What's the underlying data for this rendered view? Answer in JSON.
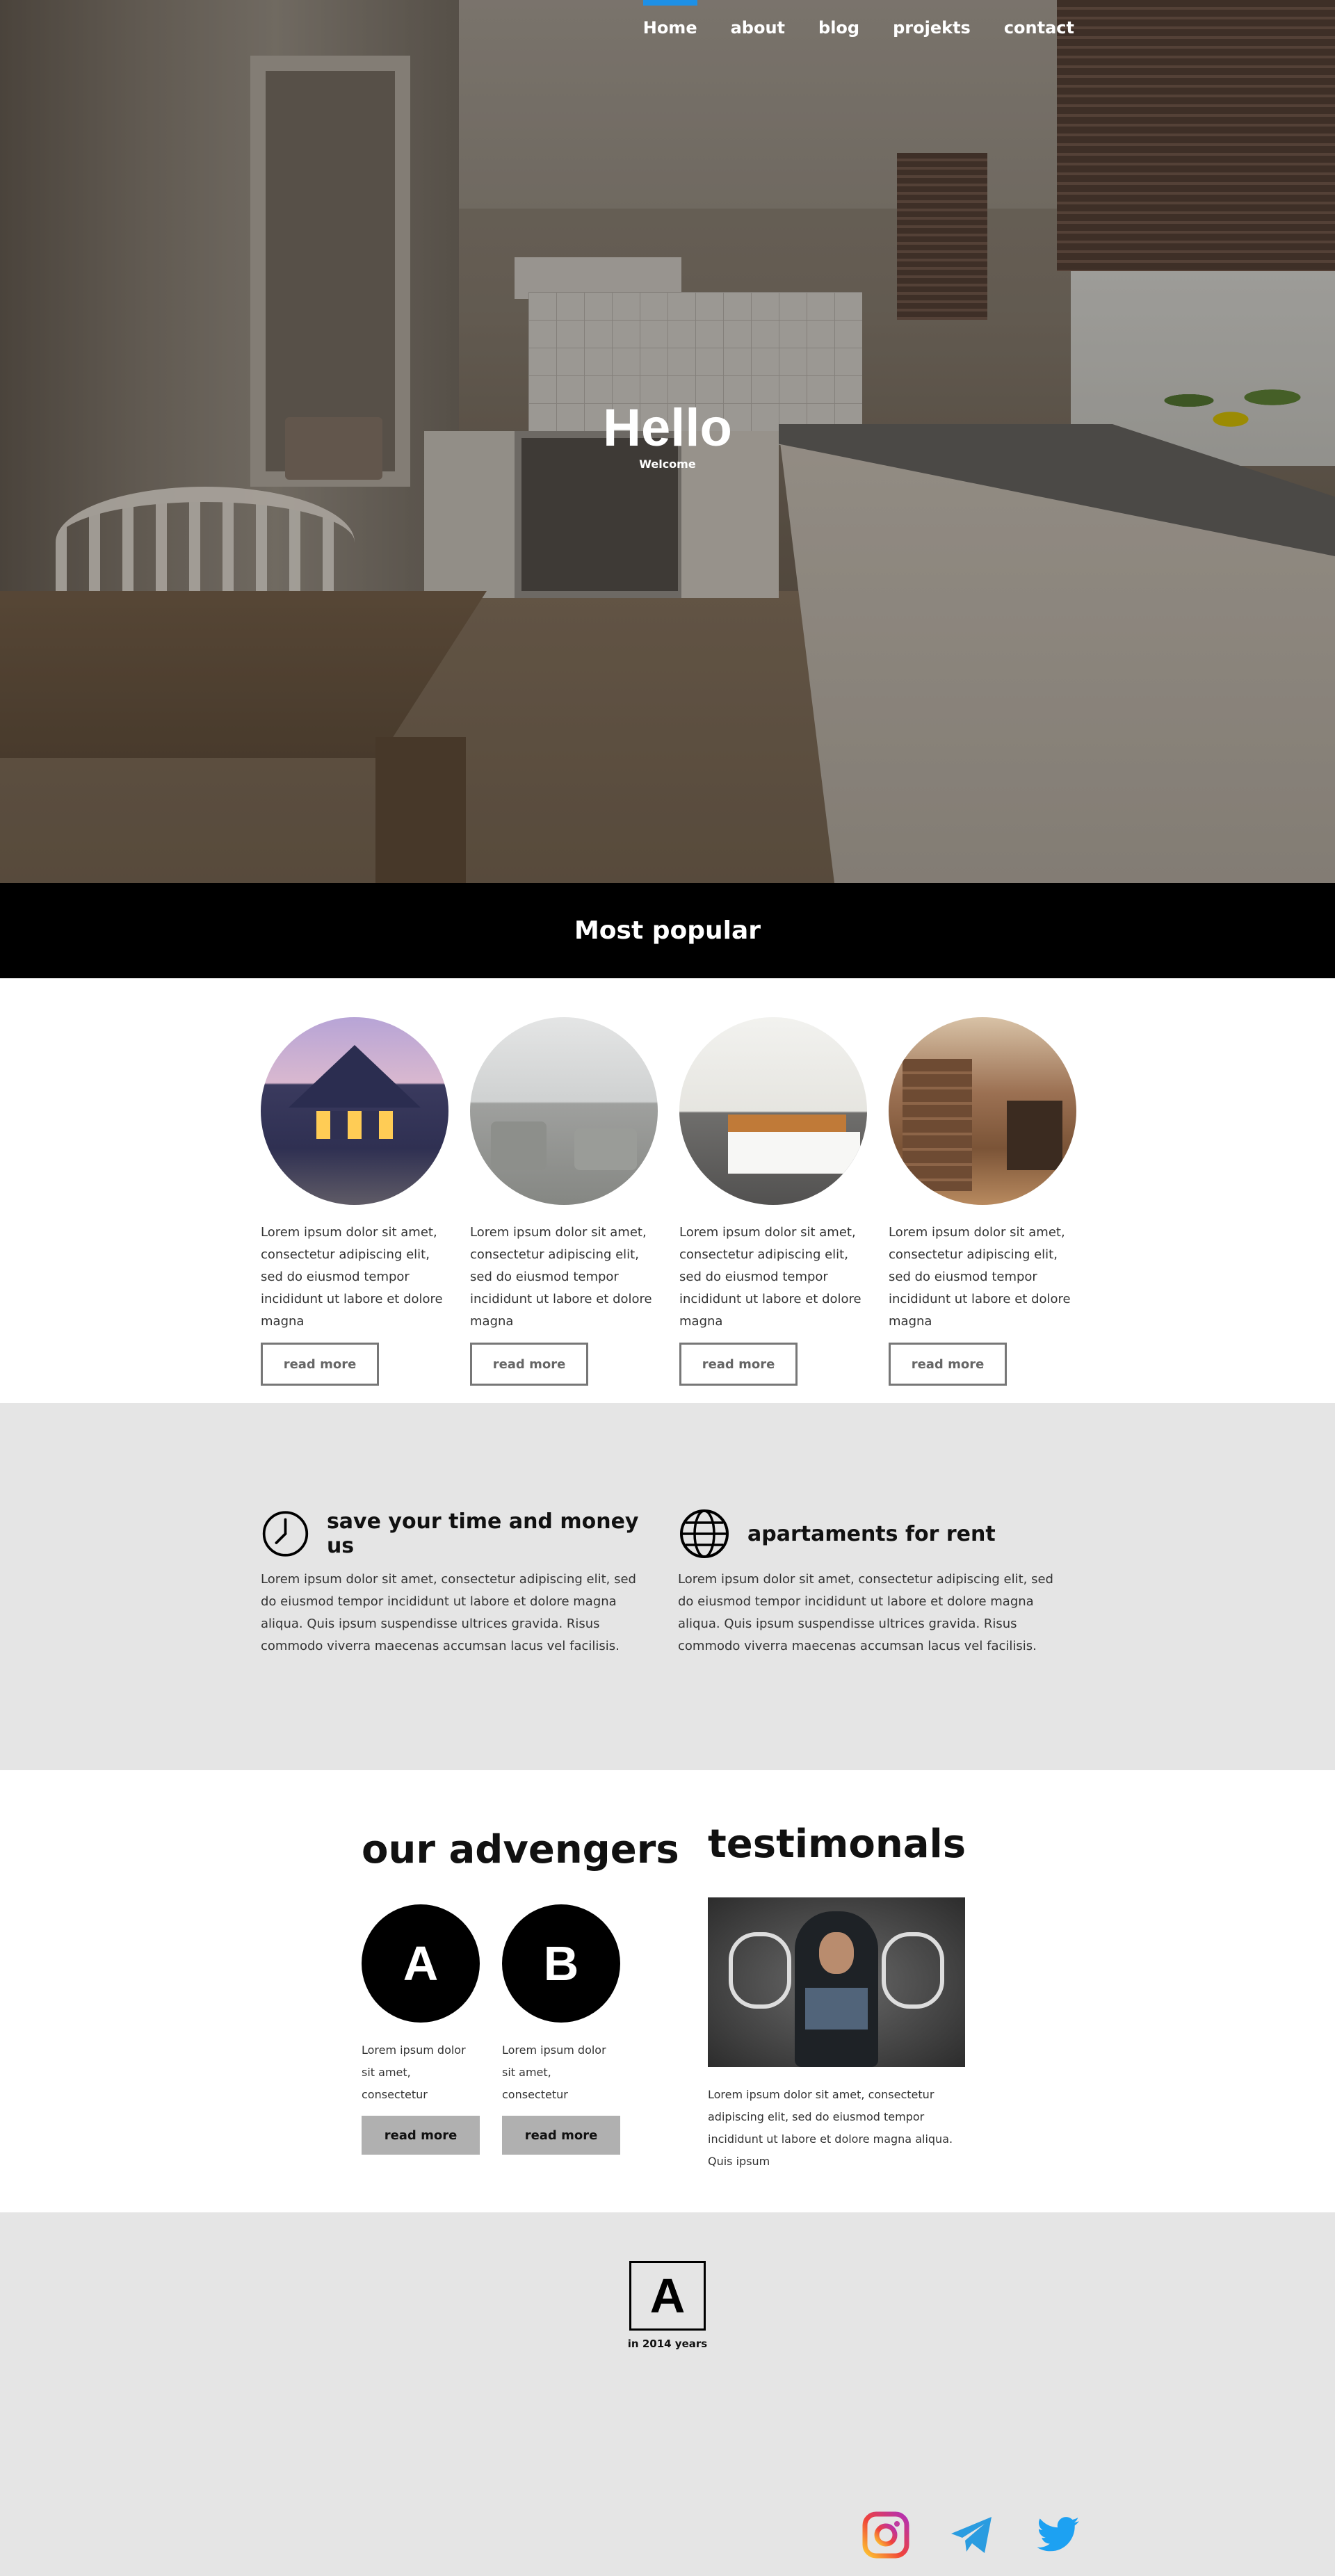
{
  "nav": {
    "items": [
      {
        "label": "Home",
        "active": true
      },
      {
        "label": "about"
      },
      {
        "label": "blog"
      },
      {
        "label": "projekts"
      },
      {
        "label": "contact"
      }
    ]
  },
  "hero": {
    "title": "Hello",
    "subtitle": "Welcome"
  },
  "popular": {
    "title": "Most popular",
    "cards": [
      {
        "image": "house-exterior",
        "text": "Lorem ipsum dolor sit amet, consectetur adipiscing elit, sed do eiusmod tempor incididunt ut labore et dolore magna",
        "button": "read more"
      },
      {
        "image": "living-room",
        "text": "Lorem ipsum dolor sit amet, consectetur adipiscing elit, sed do eiusmod tempor incididunt ut labore et dolore magna",
        "button": "read more"
      },
      {
        "image": "white-kitchen",
        "text": "Lorem ipsum dolor sit amet, consectetur adipiscing elit, sed do eiusmod tempor incididunt ut labore et dolore magna",
        "button": "read more"
      },
      {
        "image": "wood-kitchen",
        "text": "Lorem ipsum dolor sit amet, consectetur adipiscing elit, sed do eiusmod tempor incididunt ut labore et dolore magna",
        "button": "read more"
      }
    ]
  },
  "features": [
    {
      "icon": "clock-icon",
      "title": "save your time and money us",
      "text": "Lorem ipsum dolor sit amet, consectetur adipiscing elit, sed do eiusmod tempor incididunt ut labore et dolore magna aliqua. Quis ipsum suspendisse ultrices gravida. Risus commodo viverra maecenas accumsan lacus vel facilisis."
    },
    {
      "icon": "globe-icon",
      "title": "apartaments for rent",
      "text": "Lorem ipsum dolor sit amet, consectetur adipiscing elit, sed do eiusmod tempor incididunt ut labore et dolore magna aliqua. Quis ipsum suspendisse ultrices gravida. Risus commodo viverra maecenas accumsan lacus vel facilisis."
    }
  ],
  "advengers": {
    "title": "our advengers",
    "members": [
      {
        "letter": "A",
        "text": "Lorem ipsum dolor sit amet, consectetur",
        "button": "read more"
      },
      {
        "letter": "B",
        "text": "Lorem ipsum dolor sit amet, consectetur",
        "button": "read more"
      }
    ]
  },
  "testimonials": {
    "title": "testimonals",
    "image": "man-with-chalk-muscles",
    "text": "Lorem ipsum dolor sit amet, consectetur adipiscing elit, sed do eiusmod tempor incididunt ut labore et dolore magna aliqua. Quis ipsum"
  },
  "footer": {
    "logo_letter": "A",
    "caption": "in 2014 years",
    "socials": [
      "instagram-icon",
      "telegram-icon",
      "twitter-icon"
    ]
  },
  "colors": {
    "accent": "#1e90e6",
    "footer_bg": "#e5e5e5",
    "button_gray": "#b0b0b0"
  }
}
